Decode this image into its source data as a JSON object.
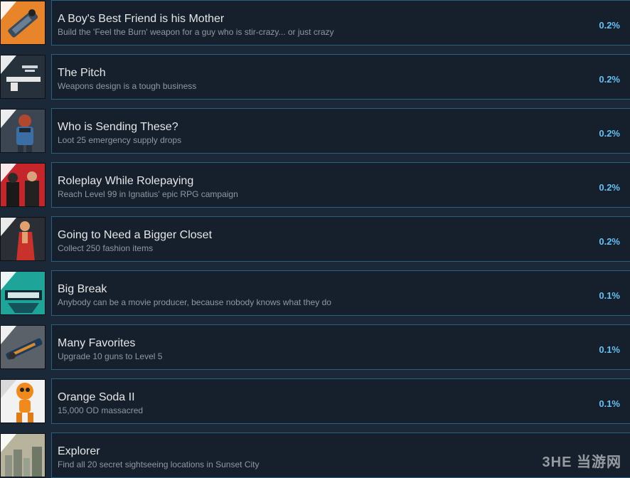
{
  "achievements": [
    {
      "title": "A Boy's Best Friend is his Mother",
      "description": "Build the 'Feel the Burn' weapon for a guy who is stir-crazy... or just crazy",
      "percent": "0.2%",
      "icon": "rocket-launcher-icon",
      "icon_bg": "#e8842a"
    },
    {
      "title": "The Pitch",
      "description": "Weapons design is a tough business",
      "percent": "0.2%",
      "icon": "weapon-blueprint-icon",
      "icon_bg": "#27313b"
    },
    {
      "title": "Who is Sending These?",
      "description": "Loot 25 emergency supply drops",
      "percent": "0.2%",
      "icon": "pilot-character-icon",
      "icon_bg": "#3b4652"
    },
    {
      "title": "Roleplay While Rolepaying",
      "description": "Reach Level 99 in Ignatius' epic RPG campaign",
      "percent": "0.2%",
      "icon": "rpg-characters-icon",
      "icon_bg": "#c5262b"
    },
    {
      "title": "Going to Need a Bigger Closet",
      "description": "Collect 250 fashion items",
      "percent": "0.2%",
      "icon": "fashion-character-icon",
      "icon_bg": "#2b2f35"
    },
    {
      "title": "Big Break",
      "description": "Anybody can be a movie producer, because nobody knows what they do",
      "percent": "0.1%",
      "icon": "movie-poster-icon",
      "icon_bg": "#1fa49a"
    },
    {
      "title": "Many Favorites",
      "description": "Upgrade 10 guns to Level 5",
      "percent": "0.1%",
      "icon": "gun-icon",
      "icon_bg": "#5b6169"
    },
    {
      "title": "Orange Soda II",
      "description": "15,000 OD massacred",
      "percent": "0.1%",
      "icon": "orange-mascot-icon",
      "icon_bg": "#f2f2f2"
    },
    {
      "title": "Explorer",
      "description": "Find all 20 secret sightseeing locations in Sunset City",
      "percent": "",
      "icon": "city-skyline-icon",
      "icon_bg": "#b7b39c"
    }
  ],
  "watermark": "3HE 当游网"
}
